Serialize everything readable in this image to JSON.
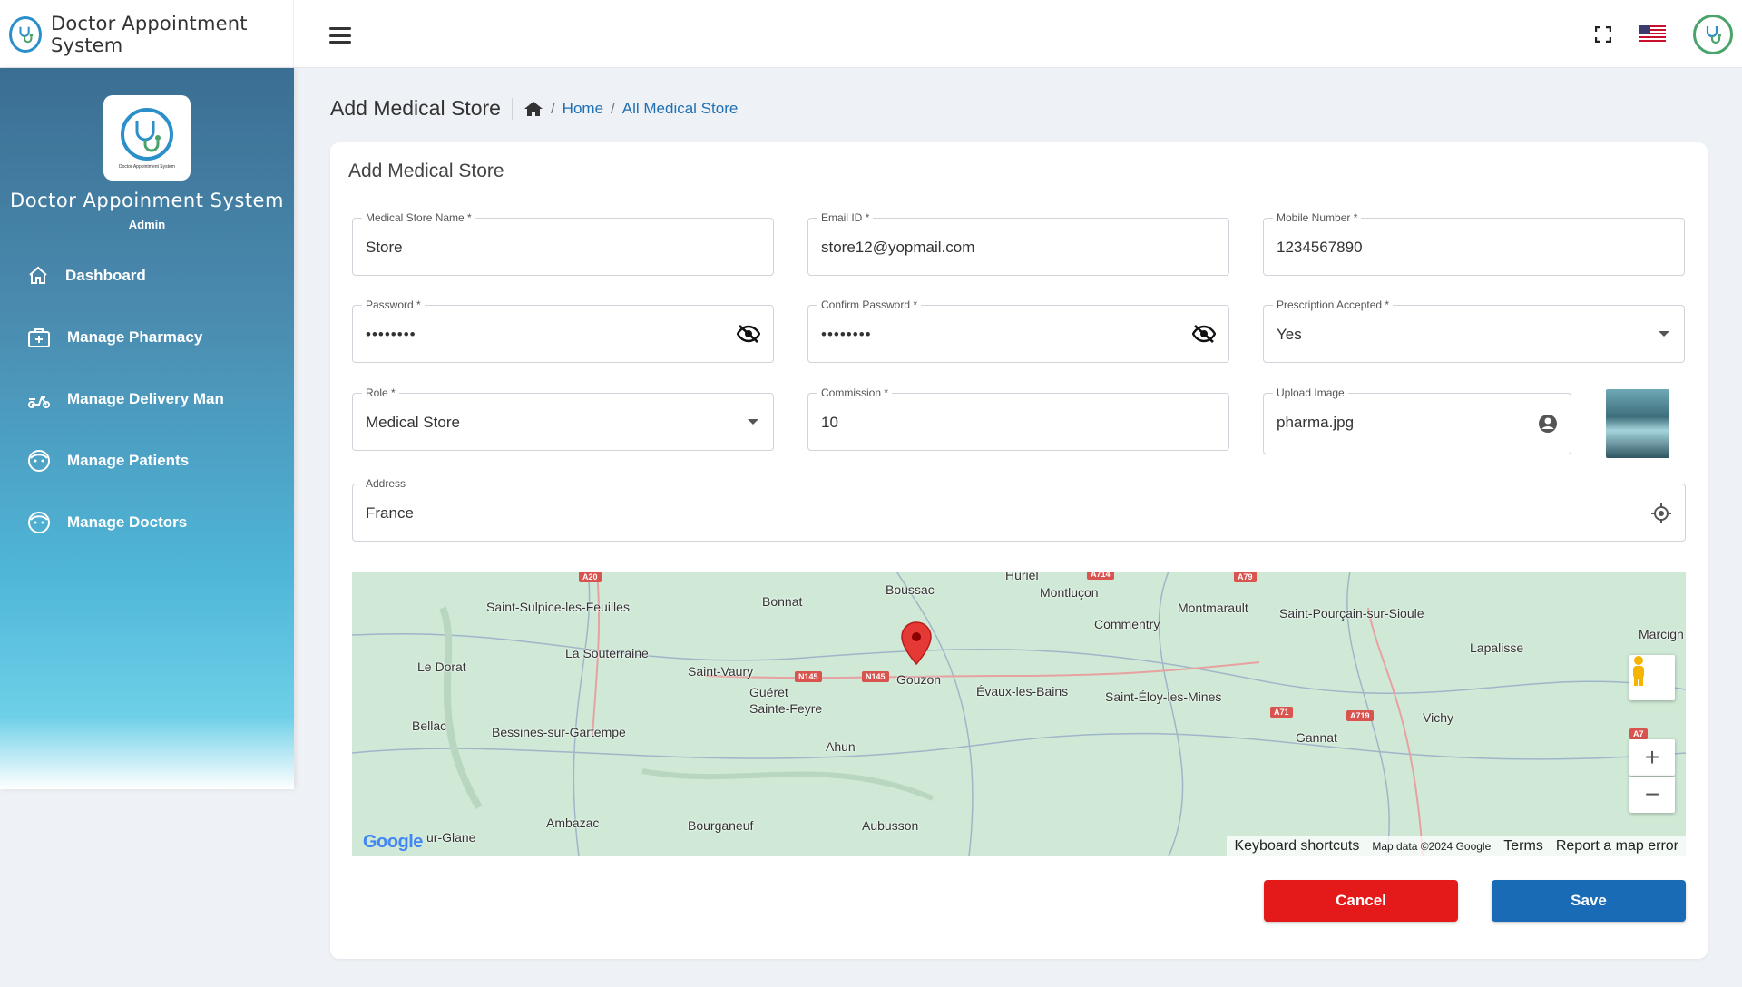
{
  "app": {
    "title": "Doctor Appointment System",
    "logo_caption": "Doctor Appointment System"
  },
  "sidebar": {
    "title": "Doctor Appoinment System",
    "role": "Admin",
    "items": [
      {
        "label": "Dashboard",
        "icon": "home-icon"
      },
      {
        "label": "Manage Pharmacy",
        "icon": "medical-kit-icon"
      },
      {
        "label": "Manage Delivery Man",
        "icon": "scooter-icon"
      },
      {
        "label": "Manage Patients",
        "icon": "face-icon"
      },
      {
        "label": "Manage Doctors",
        "icon": "face-icon"
      }
    ]
  },
  "header": {
    "page_title": "Add Medical Store",
    "breadcrumb": {
      "home": "Home",
      "current": "All Medical Store",
      "sep": "/"
    }
  },
  "form": {
    "title": "Add Medical Store",
    "store_name": {
      "label": "Medical Store Name *",
      "value": "Store"
    },
    "email": {
      "label": "Email ID *",
      "value": "store12@yopmail.com"
    },
    "mobile": {
      "label": "Mobile Number *",
      "value": "1234567890"
    },
    "password": {
      "label": "Password *",
      "value": "••••••••"
    },
    "confirm_password": {
      "label": "Confirm Password *",
      "value": "••••••••"
    },
    "prescription": {
      "label": "Prescription Accepted *",
      "value": "Yes"
    },
    "role": {
      "label": "Role *",
      "value": "Medical Store"
    },
    "commission": {
      "label": "Commission *",
      "value": "10"
    },
    "upload": {
      "label": "Upload Image",
      "value": "pharma.jpg"
    },
    "address": {
      "label": "Address",
      "value": "France"
    }
  },
  "map": {
    "places": [
      {
        "name": "Huriel"
      },
      {
        "name": "Boussac"
      },
      {
        "name": "Montluçon"
      },
      {
        "name": "Montmarault"
      },
      {
        "name": "Saint-Pourçain-sur-Sioule"
      },
      {
        "name": "Saint-Sulpice-les-Feuilles"
      },
      {
        "name": "Bonnat"
      },
      {
        "name": "Commentry"
      },
      {
        "name": "Lapalisse"
      },
      {
        "name": "Marcign"
      },
      {
        "name": "La Souterraine"
      },
      {
        "name": "Le Dorat"
      },
      {
        "name": "Saint-Vaury"
      },
      {
        "name": "Gouzon"
      },
      {
        "name": "Guéret"
      },
      {
        "name": "Évaux-les-Bains"
      },
      {
        "name": "Saint-Éloy-les-Mines"
      },
      {
        "name": "Sainte-Feyre"
      },
      {
        "name": "Bellac"
      },
      {
        "name": "Bessines-sur-Gartempe"
      },
      {
        "name": "Vichy"
      },
      {
        "name": "Gannat"
      },
      {
        "name": "Ahun"
      },
      {
        "name": "Ambazac"
      },
      {
        "name": "Bourganeuf"
      },
      {
        "name": "Aubusson"
      },
      {
        "name": "ur-Glane"
      }
    ],
    "roads": [
      "A20",
      "A714",
      "A79",
      "N145",
      "N145",
      "A71",
      "A719",
      "A7"
    ],
    "footer": {
      "shortcuts": "Keyboard shortcuts",
      "data": "Map data ©2024 Google",
      "terms": "Terms",
      "report": "Report a map error"
    },
    "zoom_in": "+",
    "zoom_out": "−",
    "google": "Google"
  },
  "actions": {
    "cancel": "Cancel",
    "save": "Save"
  },
  "colors": {
    "primary": "#1a6bb5",
    "danger": "#e41a1a",
    "link": "#1f6fb2"
  }
}
